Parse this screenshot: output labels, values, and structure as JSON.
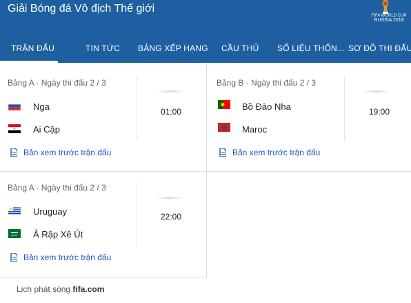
{
  "header": {
    "title": "Giải Bóng đá Vô địch Thế giới",
    "logo": {
      "line1": "FIFA WORLD CUP",
      "line2": "RUSSIA 2018"
    },
    "tabs": [
      {
        "label": "Trận đấu",
        "active": true
      },
      {
        "label": "Tin tức"
      },
      {
        "label": "Bảng xếp hạng"
      },
      {
        "label": "Cầu thủ"
      },
      {
        "label": "Số liệu thốn..."
      },
      {
        "label": "Sơ đồ thi đấu"
      }
    ]
  },
  "matches": [
    {
      "group": "Bảng A · Ngày thi đấu 2 / 3",
      "home": {
        "name": "Nga",
        "flag": "russia-flag"
      },
      "away": {
        "name": "Ai Cập",
        "flag": "egypt-flag"
      },
      "time": "01:00",
      "preview": "Bản xem trước trận đấu"
    },
    {
      "group": "Bảng B · Ngày thi đấu 2 / 3",
      "home": {
        "name": "Bồ Đào Nha",
        "flag": "portugal-flag"
      },
      "away": {
        "name": "Maroc",
        "flag": "morocco-flag"
      },
      "time": "19:00",
      "preview": "Bản xem trước trận đấu"
    },
    {
      "group": "Bảng A · Ngày thi đấu 2 / 3",
      "home": {
        "name": "Uruguay",
        "flag": "uruguay-flag"
      },
      "away": {
        "name": "Ả Rập Xê Út",
        "flag": "saudi-arabia-flag"
      },
      "time": "22:00",
      "preview": "Bản xem trước trận đấu"
    }
  ],
  "footer": {
    "prefix": "Lịch phát sóng",
    "source": "fifa.com"
  },
  "colors": {
    "header_bg": "#1d5fa0",
    "link": "#1a56c4"
  }
}
